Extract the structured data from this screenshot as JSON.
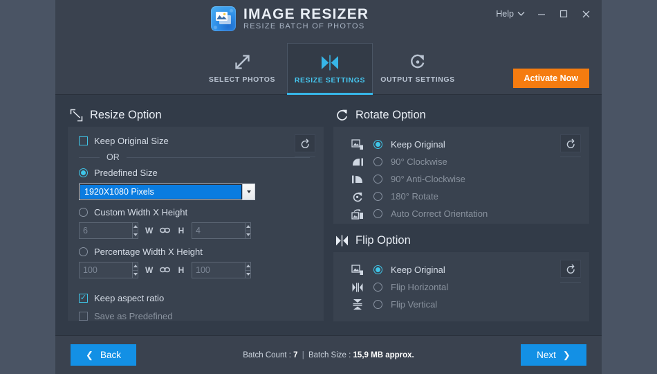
{
  "window": {
    "help_label": "Help",
    "minimize_icon": "minimize-icon",
    "maximize_icon": "maximize-icon",
    "close_icon": "close-icon"
  },
  "brand": {
    "title": "IMAGE RESIZER",
    "subtitle": "RESIZE BATCH OF PHOTOS",
    "logo_icon": "image-resizer-logo-icon"
  },
  "tabs": [
    {
      "label": "SELECT PHOTOS",
      "icon": "expand-arrows-icon",
      "active": false
    },
    {
      "label": "RESIZE SETTINGS",
      "icon": "resize-hourglass-icon",
      "active": true
    },
    {
      "label": "OUTPUT SETTINGS",
      "icon": "refresh-circle-icon",
      "active": false
    }
  ],
  "activate": {
    "label": "Activate Now"
  },
  "resize_option": {
    "title": "Resize Option",
    "icon": "resize-diagonal-icon",
    "reset_icon": "reset-icon",
    "keep_original_size": {
      "label": "Keep Original Size",
      "checked": false
    },
    "or_label": "OR",
    "predefined_size": {
      "label": "Predefined Size",
      "selected": true
    },
    "predefined_dropdown": {
      "value": "1920X1080 Pixels",
      "arrow_icon": "chevron-down-icon"
    },
    "custom_wh": {
      "label": "Custom Width X Height",
      "selected": false,
      "width_value": "6",
      "height_value": "4",
      "w_label": "W",
      "h_label": "H",
      "link_icon": "link-chain-icon"
    },
    "percentage_wh": {
      "label": "Percentage Width X Height",
      "selected": false,
      "width_value": "100",
      "height_value": "100",
      "w_label": "W",
      "h_label": "H",
      "link_icon": "link-chain-icon"
    },
    "keep_aspect_ratio": {
      "label": "Keep aspect ratio",
      "checked": true
    },
    "save_as_predefined": {
      "label": "Save as Predefined",
      "checked": false,
      "disabled": true
    }
  },
  "rotate_option": {
    "title": "Rotate Option",
    "icon": "rotate-cw-icon",
    "reset_icon": "reset-icon",
    "items": [
      {
        "label": "Keep Original",
        "icon": "keep-original-icon",
        "selected": true
      },
      {
        "label": "90° Clockwise",
        "icon": "rotate-90-cw-icon",
        "selected": false
      },
      {
        "label": "90° Anti-Clockwise",
        "icon": "rotate-90-ccw-icon",
        "selected": false
      },
      {
        "label": "180° Rotate",
        "icon": "rotate-180-icon",
        "selected": false
      },
      {
        "label": "Auto Correct Orientation",
        "icon": "auto-orientation-icon",
        "selected": false
      }
    ]
  },
  "flip_option": {
    "title": "Flip Option",
    "icon": "flip-icon",
    "reset_icon": "reset-icon",
    "items": [
      {
        "label": "Keep Original",
        "icon": "keep-original-icon",
        "selected": true
      },
      {
        "label": "Flip Horizontal",
        "icon": "flip-horizontal-icon",
        "selected": false
      },
      {
        "label": "Flip Vertical",
        "icon": "flip-vertical-icon",
        "selected": false
      }
    ]
  },
  "footer": {
    "back_label": "Back",
    "back_chevron": "chevron-left-icon",
    "next_label": "Next",
    "next_chevron": "chevron-right-icon",
    "batch_count_label": "Batch Count :",
    "batch_count_value": "7",
    "separator": "|",
    "batch_size_label": "Batch Size :",
    "batch_size_value": "15,9 MB approx."
  },
  "colors": {
    "desktop": "#4a5464",
    "window_bg": "#323b48",
    "chrome": "#3a424f",
    "panel": "#39424f",
    "accent_cyan": "#3fc6e8",
    "accent_blue": "#1390e5",
    "dropdown_blue": "#0a7ce0",
    "activate_orange": "#f57c10",
    "text_primary": "#e9eef5",
    "text_dim": "#89929e"
  }
}
